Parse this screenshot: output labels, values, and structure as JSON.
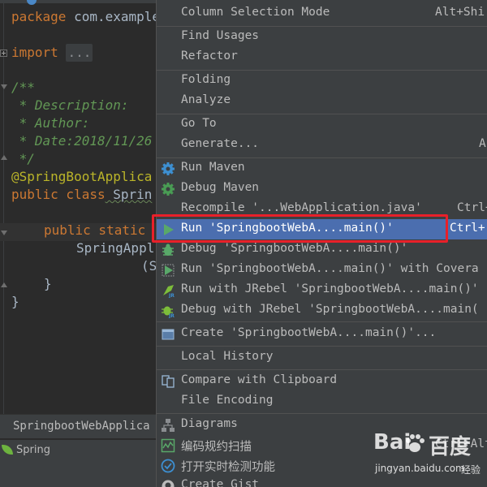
{
  "editor": {
    "lines": {
      "l1_kw": "package",
      "l1_rest": " com.example",
      "l2_kw": "import",
      "l2_fold": "...",
      "l3": "/**",
      "l4": " * Description:",
      "l5": " * Author:",
      "l6": " * Date:2018/11/26",
      "l7": " */",
      "l8": "@SpringBootApplica",
      "l9_kw": "public class",
      "l9_rest": " Sprin",
      "l10_kw": "public static",
      "l11": "SpringAppl",
      "l12": "(S",
      "l13": "}",
      "l14": "}"
    }
  },
  "bottom": {
    "structure_label": "SpringbootWebApplica",
    "spring_label": "Spring"
  },
  "menu": {
    "items": [
      {
        "label": "Column Selection Mode",
        "shortcut": "Alt+Shi"
      },
      {
        "label": "Find Usages"
      },
      {
        "label": "Refactor"
      },
      {
        "label": "Folding"
      },
      {
        "label": "Analyze"
      },
      {
        "label": "Go To"
      },
      {
        "label": "Generate...",
        "shortcut": "A"
      },
      {
        "label": "Run Maven",
        "icon": "maven-gear-icon"
      },
      {
        "label": "Debug Maven",
        "icon": "maven-debug-icon"
      },
      {
        "label": "Recompile '...WebApplication.java'",
        "shortcut": "Ctrl+"
      },
      {
        "label": "Run 'SpringbootWebA....main()'",
        "shortcut": "Ctrl+",
        "icon": "run-icon"
      },
      {
        "label": "Debug 'SpringbootWebA....main()'",
        "icon": "debug-icon"
      },
      {
        "label": "Run 'SpringbootWebA....main()' with Covera",
        "icon": "coverage-icon"
      },
      {
        "label": "Run with JRebel 'SpringbootWebA....main()'",
        "icon": "jrebel-run-icon"
      },
      {
        "label": "Debug with JRebel 'SpringbootWebA....main(",
        "icon": "jrebel-debug-icon"
      },
      {
        "label": "Create 'SpringbootWebA....main()'...",
        "icon": "run-config-icon"
      },
      {
        "label": "Local History"
      },
      {
        "label": "Compare with Clipboard",
        "icon": "compare-icon"
      },
      {
        "label": "File Encoding"
      },
      {
        "label": "Diagrams",
        "icon": "diagram-icon"
      },
      {
        "label": "编码规约扫描",
        "shortcut": "Ctrl+Alt",
        "icon": "code-scan-icon"
      },
      {
        "label": "打开实时检测功能",
        "icon": "realtime-check-icon"
      },
      {
        "label": "Create Gist",
        "icon": "github-icon"
      }
    ]
  },
  "watermark": {
    "brand_left": "Bai",
    "brand_right": "百度",
    "site": "jingyan.baidu.com",
    "subtitle": "经验"
  },
  "colors": {
    "highlight": "#4b6eaf",
    "annotation_box": "#e8202a",
    "run_green": "#59a869"
  }
}
